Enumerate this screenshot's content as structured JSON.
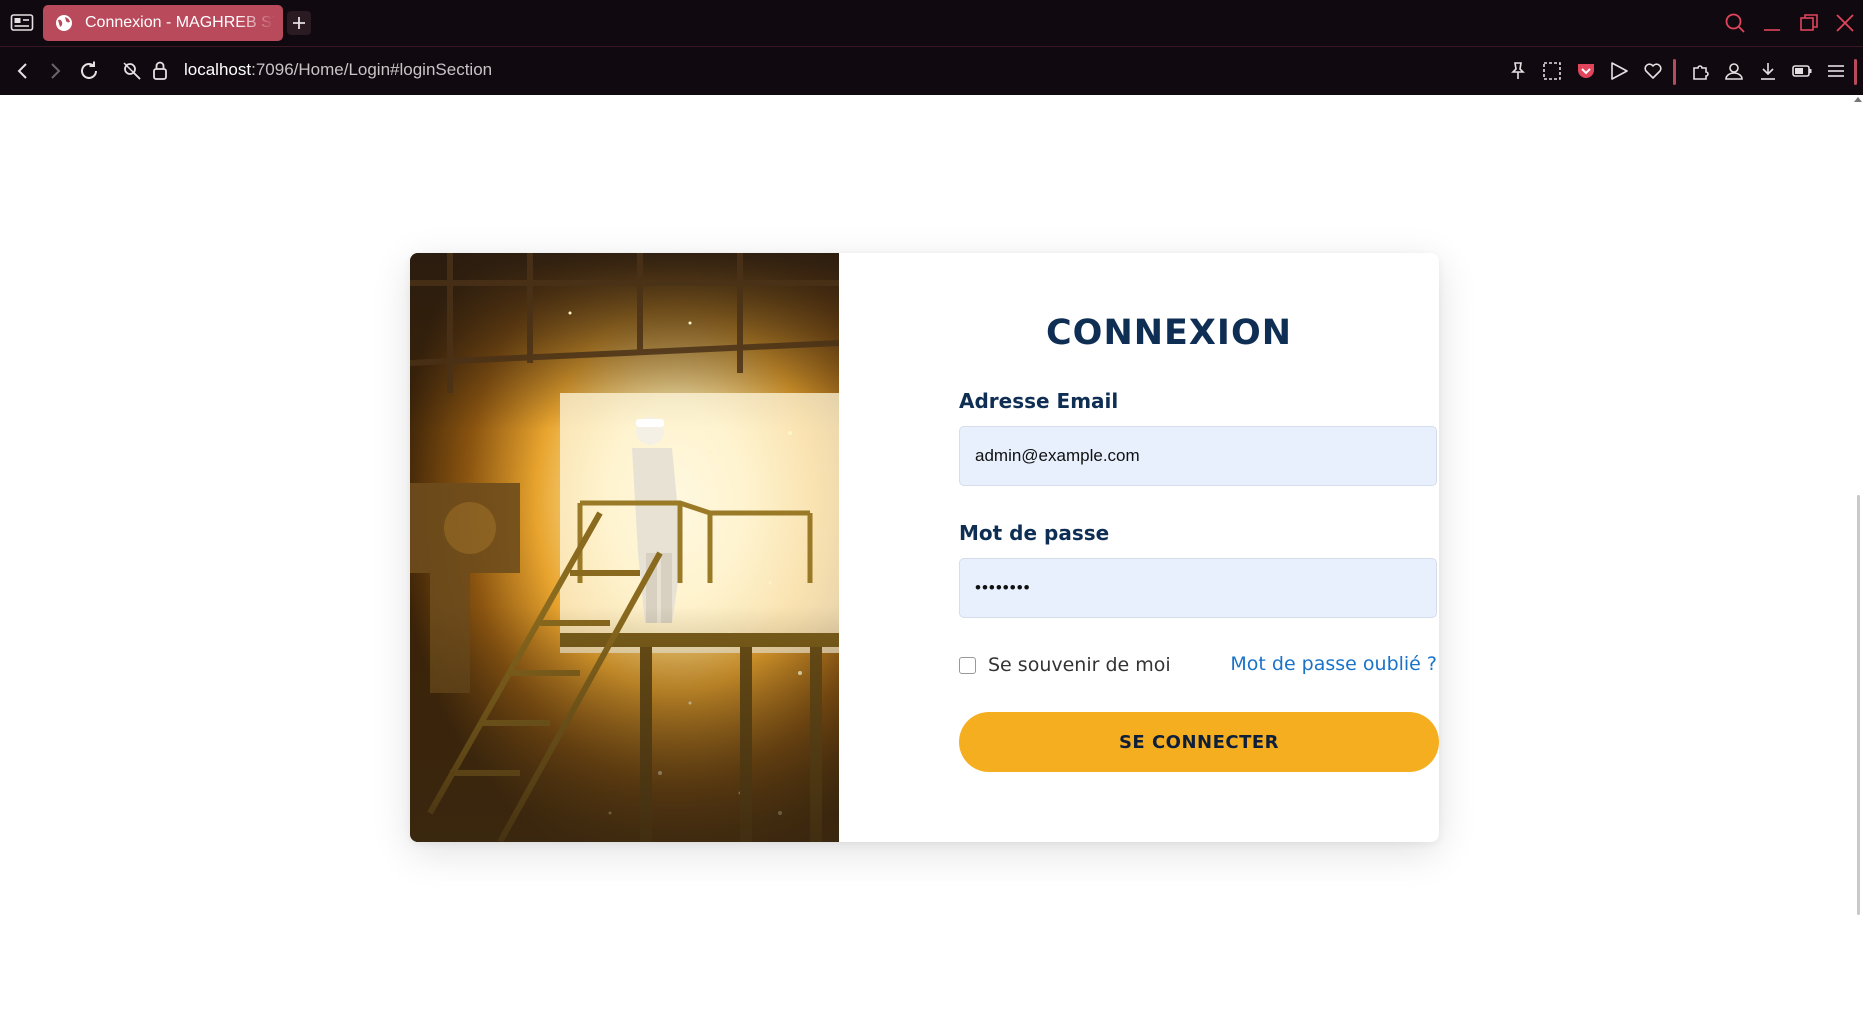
{
  "browser": {
    "tab_title": "Connexion - MAGHREB STEEL",
    "url_host": "localhost",
    "url_rest": ":7096/Home/Login#loginSection",
    "accent_color": "#b94a5c"
  },
  "login": {
    "title": "CONNEXION",
    "email_label": "Adresse Email",
    "email_value": "admin@example.com",
    "password_label": "Mot de passe",
    "password_value": "••••••••",
    "remember_label": "Se souvenir de moi",
    "remember_checked": false,
    "forgot_link": "Mot de passe oublié ?",
    "submit_label": "SE CONNECTER",
    "button_color": "#f5ae20",
    "heading_color": "#0f2e54"
  }
}
